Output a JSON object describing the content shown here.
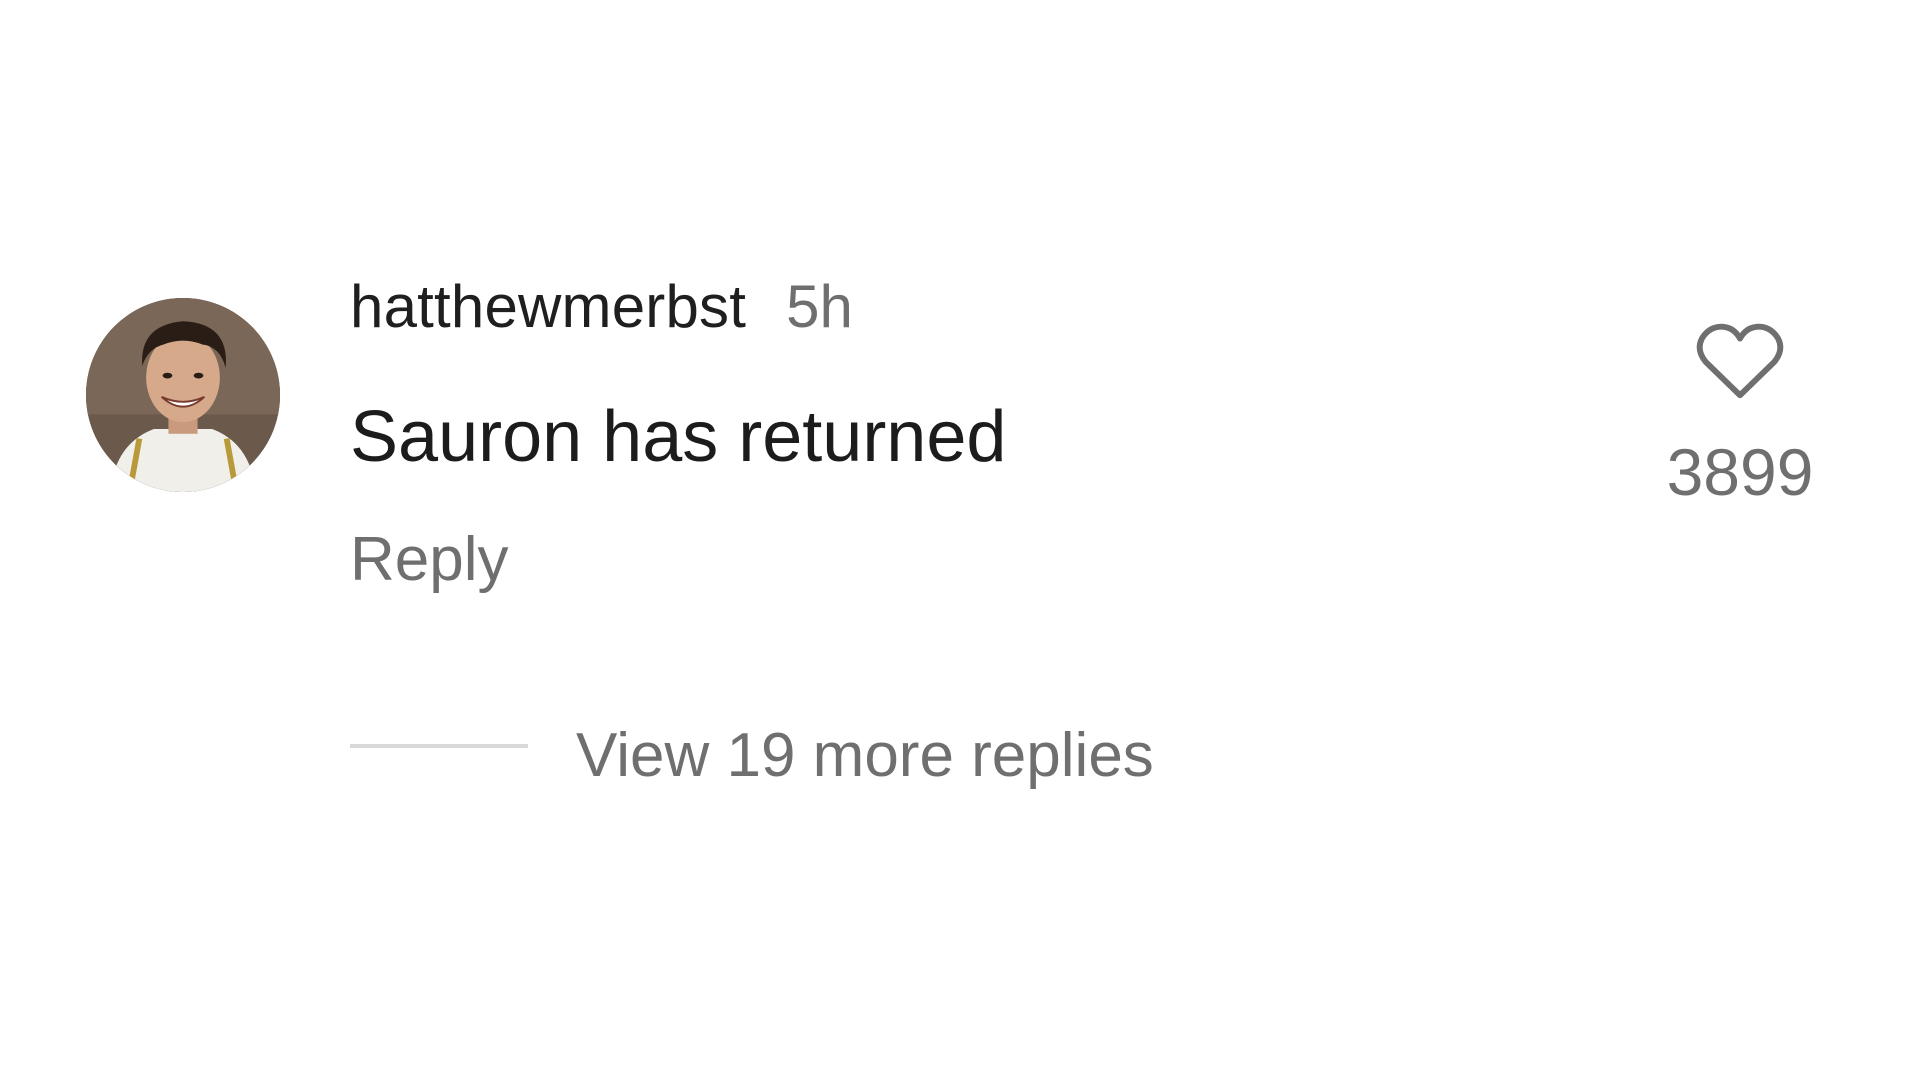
{
  "comment": {
    "username": "hatthewmerbst",
    "time_ago": "5h",
    "text": "Sauron has returned",
    "reply_label": "Reply",
    "view_replies_label": "View 19 more replies",
    "like_count": "3899",
    "avatar_icon": "user-avatar-photo",
    "like_icon": "heart-outline-icon"
  },
  "colors": {
    "primary_text": "#1f1f1f",
    "secondary_text": "#6f6f6f",
    "divider": "#d9d9d9",
    "background": "#ffffff"
  }
}
